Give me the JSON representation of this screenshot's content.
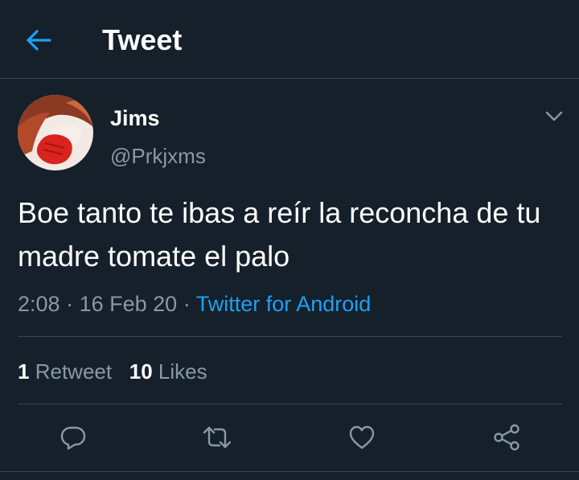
{
  "header": {
    "title": "Tweet",
    "back_icon": "arrow-left-icon"
  },
  "tweet": {
    "author": {
      "name": "Jims",
      "handle": "@Prkjxms"
    },
    "text": "Boe tanto te ibas a reír la reconcha de tu madre tomate el palo",
    "time": "2:08",
    "separator": "·",
    "date": "16 Feb 20",
    "source": "Twitter for Android"
  },
  "stats": {
    "retweets_count": "1",
    "retweets_label": "Retweet",
    "likes_count": "10",
    "likes_label": "Likes"
  },
  "actions": [
    "reply-icon",
    "retweet-icon",
    "like-icon",
    "share-icon"
  ],
  "colors": {
    "background": "#15202b",
    "accent": "#1da1f2",
    "secondary_text": "#8899a6",
    "divider": "#38444d"
  }
}
